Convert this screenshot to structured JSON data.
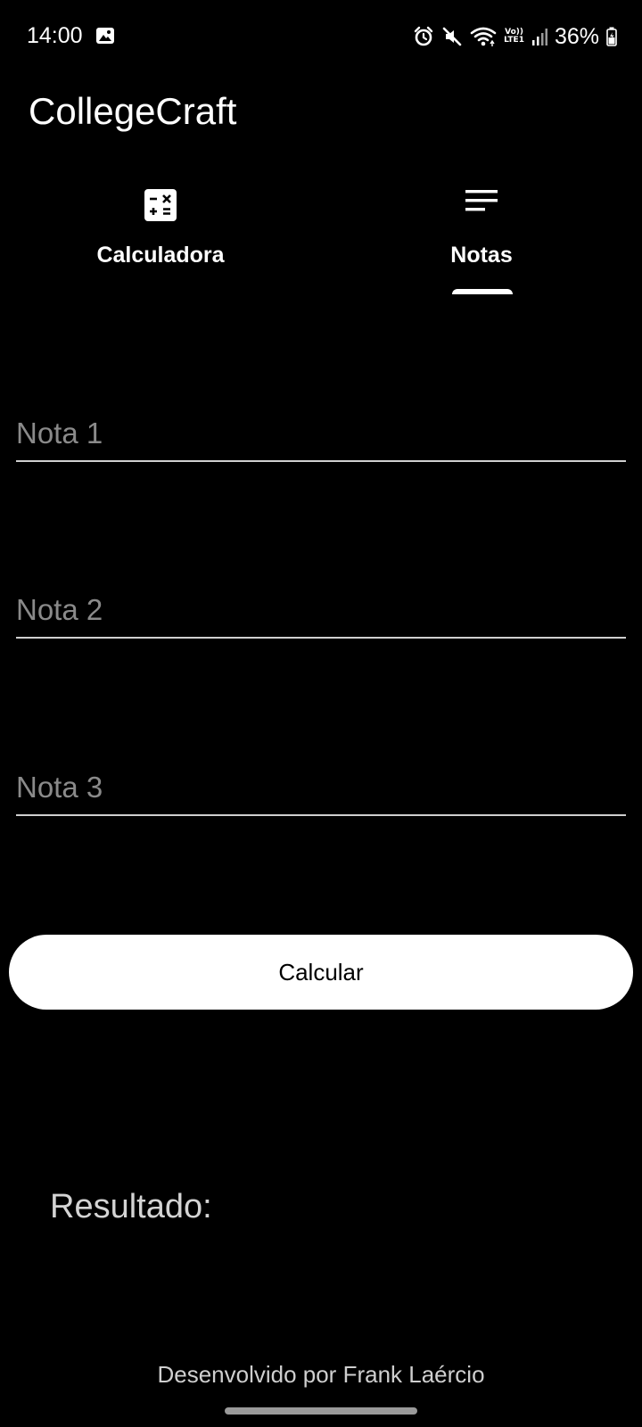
{
  "status_bar": {
    "time": "14:00",
    "volte_top": "Vo))",
    "volte_bottom": "LTE1",
    "battery": "36%",
    "icons": [
      "gallery-icon",
      "alarm-icon",
      "mute-icon",
      "wifi-icon",
      "signal-icon",
      "battery-icon"
    ]
  },
  "app": {
    "title": "CollegeCraft"
  },
  "tabs": [
    {
      "label": "Calculadora",
      "icon": "calculator-icon",
      "selected": false
    },
    {
      "label": "Notas",
      "icon": "notes-icon",
      "selected": true
    }
  ],
  "form": {
    "nota1_placeholder": "Nota 1",
    "nota2_placeholder": "Nota 2",
    "nota3_placeholder": "Nota 3",
    "nota1_value": "",
    "nota2_value": "",
    "nota3_value": ""
  },
  "calculate_button": "Calcular",
  "result_label": "Resultado:",
  "footer": "Desenvolvido por Frank Laércio",
  "colors": {
    "background": "#000000",
    "text": "#ffffff",
    "placeholder": "#8a8a8a",
    "button_bg": "#ffffff",
    "button_text": "#000000"
  }
}
